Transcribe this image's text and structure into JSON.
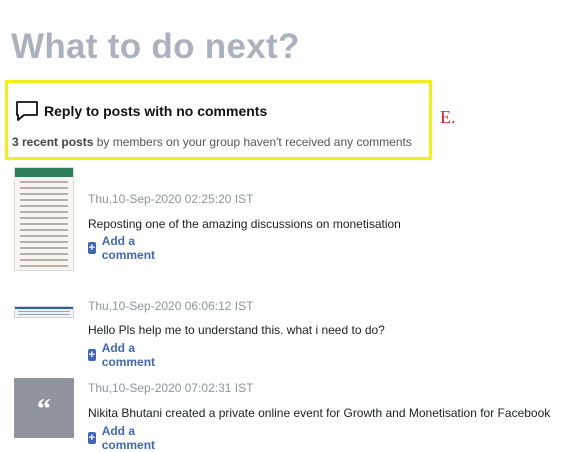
{
  "page": {
    "title": "What to do next?"
  },
  "suggestion": {
    "title": "Reply to posts with no comments",
    "count_text": "3 recent posts",
    "desc_text": " by members on your group haven't received any comments",
    "annotation": "E."
  },
  "posts": [
    {
      "timestamp": "Thu,10-Sep-2020 02:25:20 IST",
      "text": "Reposting one of the amazing discussions on monetisation",
      "action": "Add a comment",
      "thumb": "phone-screenshot"
    },
    {
      "timestamp": "Thu,10-Sep-2020 06:06:12 IST",
      "text": "Hello Pls help me to understand this. what i need to do?",
      "action": "Add a comment",
      "thumb": "desktop-screenshot"
    },
    {
      "timestamp": "Thu,10-Sep-2020 07:02:31 IST",
      "text": "Nikita Bhutani created a private online event for Growth and Monetisation for Facebook",
      "action": "Add a comment",
      "thumb": "quote-icon",
      "thumb_glyph": "“"
    }
  ],
  "colors": {
    "highlight": "#f2ee1a",
    "link": "#4267b2",
    "title": "#aab2bd",
    "annotation": "#d0202a"
  }
}
